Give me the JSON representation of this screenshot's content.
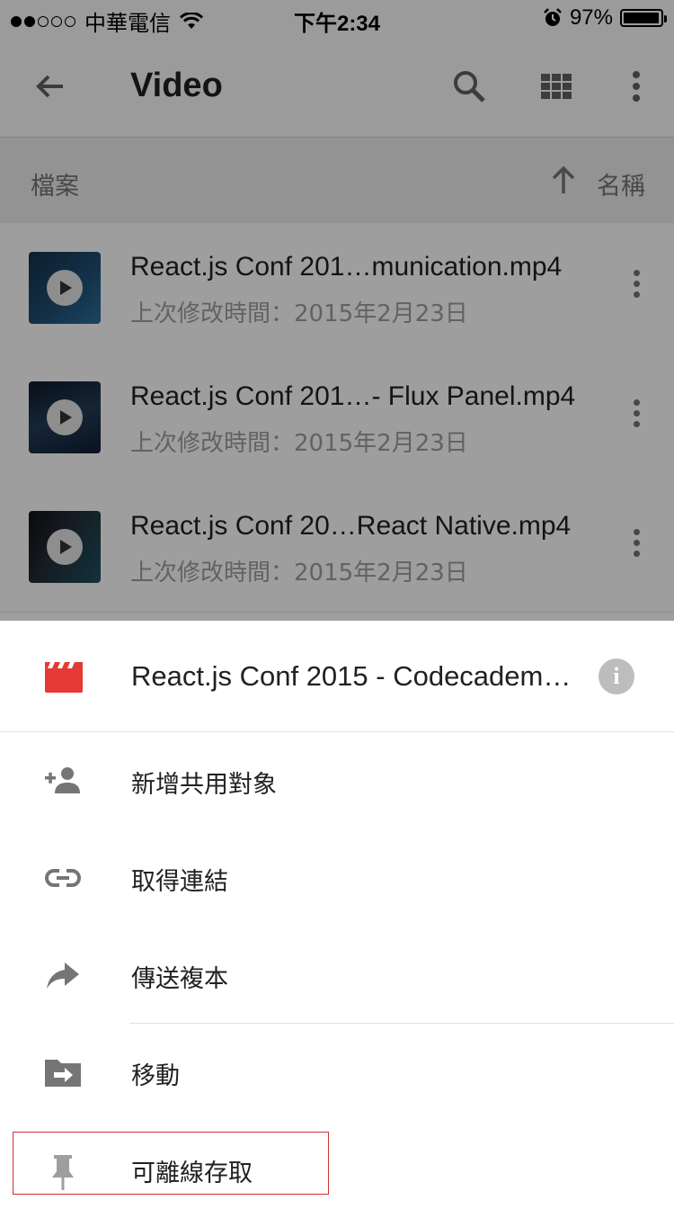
{
  "status_bar": {
    "carrier": "中華電信",
    "time": "下午2:34",
    "battery_text": "97%",
    "battery_level": 0.97
  },
  "toolbar": {
    "title": "Video",
    "icons": [
      "back-arrow-icon",
      "search-icon",
      "grid-view-icon",
      "more-vert-icon"
    ]
  },
  "sort_bar": {
    "left_label": "檔案",
    "sort_label": "名稱",
    "sort_direction_icon": "arrow-up-icon"
  },
  "files": [
    {
      "name": "React.js Conf 201…munication.mp4",
      "modified": "上次修改時間：2015年2月23日"
    },
    {
      "name": "React.js Conf 201…- Flux Panel.mp4",
      "modified": "上次修改時間：2015年2月23日"
    },
    {
      "name": "React.js Conf 20…React Native.mp4",
      "modified": "上次修改時間：2015年2月23日"
    }
  ],
  "sheet": {
    "title": "React.js Conf 2015 - Codecadem…",
    "file_icon": "video-file-icon",
    "file_icon_color": "#e53935",
    "info_icon": "info-icon",
    "items": [
      {
        "label": "新增共用對象",
        "icon": "person-add-icon"
      },
      {
        "label": "取得連結",
        "icon": "link-icon"
      },
      {
        "label": "傳送複本",
        "icon": "share-arrow-icon"
      },
      {
        "label": "移動",
        "icon": "move-folder-icon"
      },
      {
        "label": "可離線存取",
        "icon": "pin-icon"
      }
    ]
  },
  "colors": {
    "highlight_border": "#d32f2f",
    "icon_gray": "#757575"
  }
}
